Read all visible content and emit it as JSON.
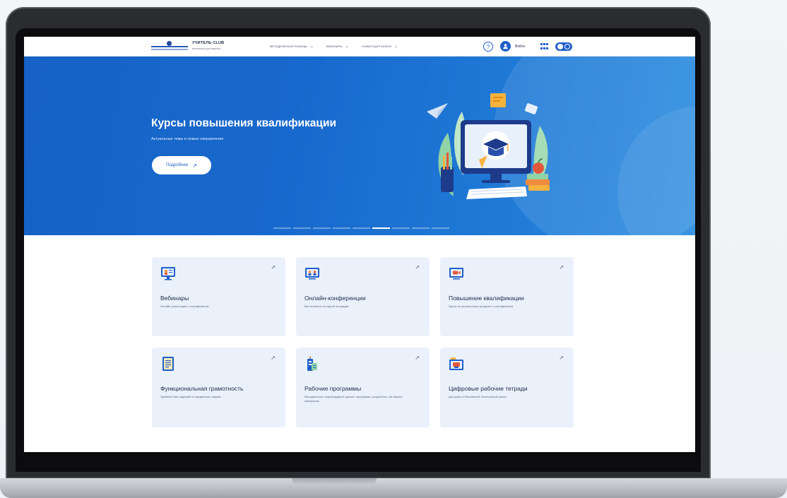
{
  "header": {
    "brand_title": "УЧИТЕЛЬ CLUB",
    "brand_subtitle": "материалы для педагога",
    "menu": [
      {
        "label": "Методическая помощь"
      },
      {
        "label": "Вебинары"
      },
      {
        "label": "Учимся для жизни"
      }
    ],
    "login_label": "Войти",
    "help_glyph": "?"
  },
  "hero": {
    "title": "Курсы повышения квалификации",
    "subtitle": "Актуальные темы и новые направления",
    "button_label": "Подробнее",
    "slides_total": 9,
    "active_slide": 6
  },
  "cards": [
    {
      "title": "Вебинары",
      "desc": "Онлайн-трансляции с сертификатом",
      "icon": "webinar-icon"
    },
    {
      "title": "Онлайн-конференции",
      "desc": "Все эксперты на одной площадке",
      "icon": "conference-icon"
    },
    {
      "title": "Повышение квалификации",
      "desc": "Курсы по актуальному профилю с сертификатом",
      "icon": "video-course-icon"
    },
    {
      "title": "Функциональная грамотность",
      "desc": "Удобный банк заданий по предметам и видам",
      "icon": "document-icon"
    },
    {
      "title": "Рабочие программы",
      "desc": "Методическое сопровождение уроков: программы, разработки, наглядные материалы",
      "icon": "program-icon"
    },
    {
      "title": "Цифровые рабочие тетради",
      "desc": "Доступны в Московской Электронной школе",
      "icon": "workbook-icon"
    }
  ],
  "colors": {
    "accent": "#1f5fc9",
    "hero_bg": "#1869cd",
    "card_bg": "#eaf1fb"
  }
}
